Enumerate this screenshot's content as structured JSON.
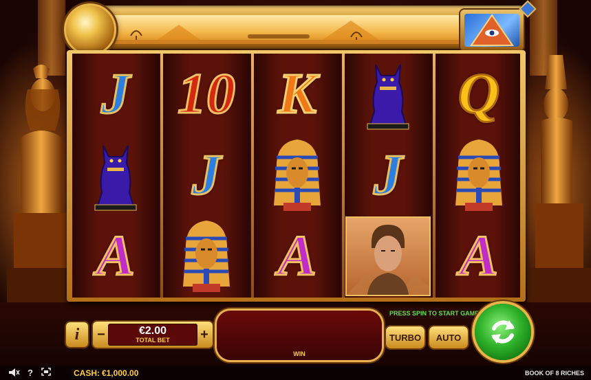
{
  "game": {
    "title": "BOOK OF 8 RICHES"
  },
  "reels": [
    [
      "J",
      "bastet-cat",
      "A"
    ],
    [
      "10",
      "J",
      "pharaoh-mask"
    ],
    [
      "K",
      "pharaoh-mask",
      "A"
    ],
    [
      "bastet-cat",
      "J",
      "adventurer"
    ],
    [
      "Q",
      "pharaoh-mask",
      "A"
    ]
  ],
  "controls": {
    "info_label": "i",
    "minus_label": "−",
    "plus_label": "+",
    "bet_amount": "€2.00",
    "bet_label": "TOTAL BET",
    "win_label": "WIN",
    "message": "PRESS SPIN TO START GAME",
    "turbo_label": "TURBO",
    "auto_label": "AUTO"
  },
  "status": {
    "cash_label": "CASH:",
    "cash_value": "€1,000.00"
  },
  "colors": {
    "accent_gold": "#e8b54a",
    "spin_green": "#2fb12a",
    "message_green": "#5ee24a",
    "label_yellow": "#ffd23c"
  }
}
